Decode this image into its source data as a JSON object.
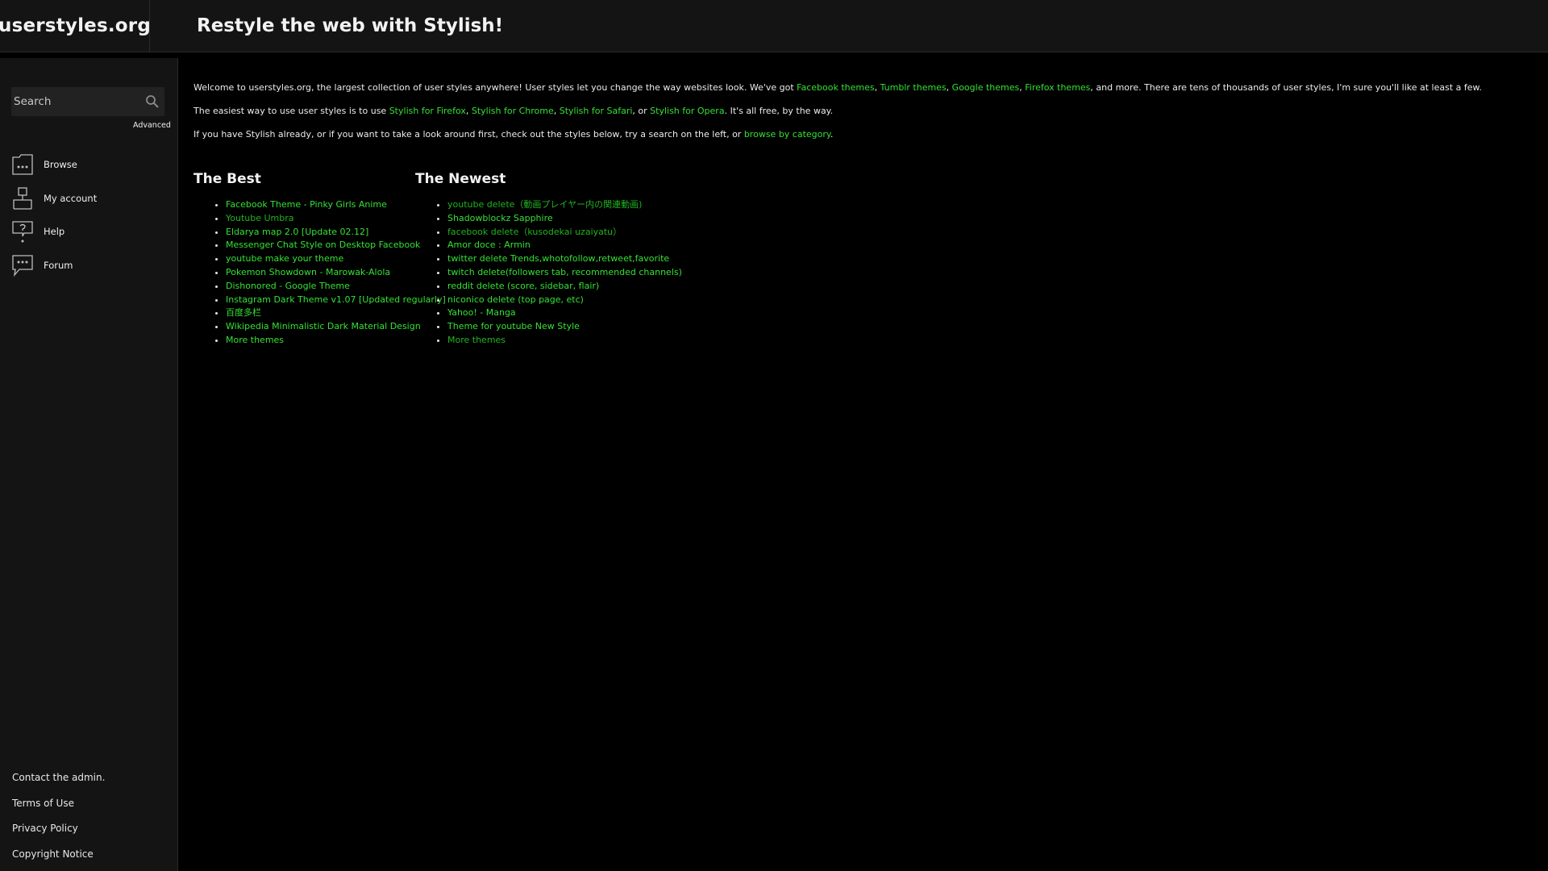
{
  "header": {
    "logo": "userstyles.org",
    "tagline": "Restyle the web with Stylish!"
  },
  "sidebar": {
    "search": {
      "placeholder": "Search",
      "value": ""
    },
    "advanced_label": "Advanced",
    "nav": [
      {
        "label": "Browse",
        "icon": "browse-folder-icon"
      },
      {
        "label": "My account",
        "icon": "account-icon"
      },
      {
        "label": "Help",
        "icon": "help-icon"
      },
      {
        "label": "Forum",
        "icon": "forum-chat-icon"
      }
    ],
    "footer_links": [
      "Contact the admin.",
      "Terms of Use",
      "Privacy Policy",
      "Copyright Notice"
    ]
  },
  "intro": {
    "p1": {
      "text1": "Welcome to userstyles.org, the largest collection of user styles anywhere! User styles let you change the way websites look. We've got ",
      "link1": "Facebook themes",
      "sep1": ", ",
      "link2": "Tumblr themes",
      "sep2": ", ",
      "link3": "Google themes",
      "sep3": ", ",
      "link4": "Firefox themes",
      "text2": ", and more. There are tens of thousands of user styles, I'm sure you'll like at least a few."
    },
    "p2": {
      "text1": "The easiest way to use user styles is to use ",
      "link1": "Stylish for Firefox",
      "sep1": ", ",
      "link2": "Stylish for Chrome",
      "sep2": ", ",
      "link3": "Stylish for Safari",
      "sep3": ", or ",
      "link4": "Stylish for Opera",
      "text2": ". It's all free, by the way."
    },
    "p3": {
      "text1": "If you have Stylish already, or if you want to take a look around first, check out the styles below, try a search on the left, or ",
      "link1": "browse by category",
      "text2": "."
    }
  },
  "best": {
    "heading": "The Best",
    "items": [
      "Facebook Theme - Pinky Girls Anime",
      "Youtube Umbra",
      "Eldarya map 2.0 [Update 02.12]",
      "Messenger Chat Style on Desktop Facebook",
      "youtube make your theme",
      "Pokemon Showdown - Marowak-Alola",
      "Dishonored - Google Theme",
      "Instagram Dark Theme v1.07 [Updated regularly]",
      "百度多栏",
      "Wikipedia Minimalistic Dark Material Design",
      "More themes"
    ]
  },
  "newest": {
    "heading": "The Newest",
    "items": [
      "youtube delete（動画プレイヤー内の関連動画)",
      "Shadowblockz Sapphire",
      "facebook delete（kusodekai uzaiyatu）",
      "Amor doce : Armin",
      "twitter delete Trends,whotofollow,retweet,favorite",
      "twitch delete(followers tab, recommended channels)",
      "reddit delete (score, sidebar, flair)",
      "niconico delete (top page, etc)",
      "Yahoo! - Manga",
      "Theme for youtube New Style",
      "More themes"
    ]
  },
  "colors": {
    "background": "#000000",
    "panel": "#141414",
    "link": "#35e135",
    "link_visited": "#22b322",
    "text": "#e6e6e6"
  }
}
